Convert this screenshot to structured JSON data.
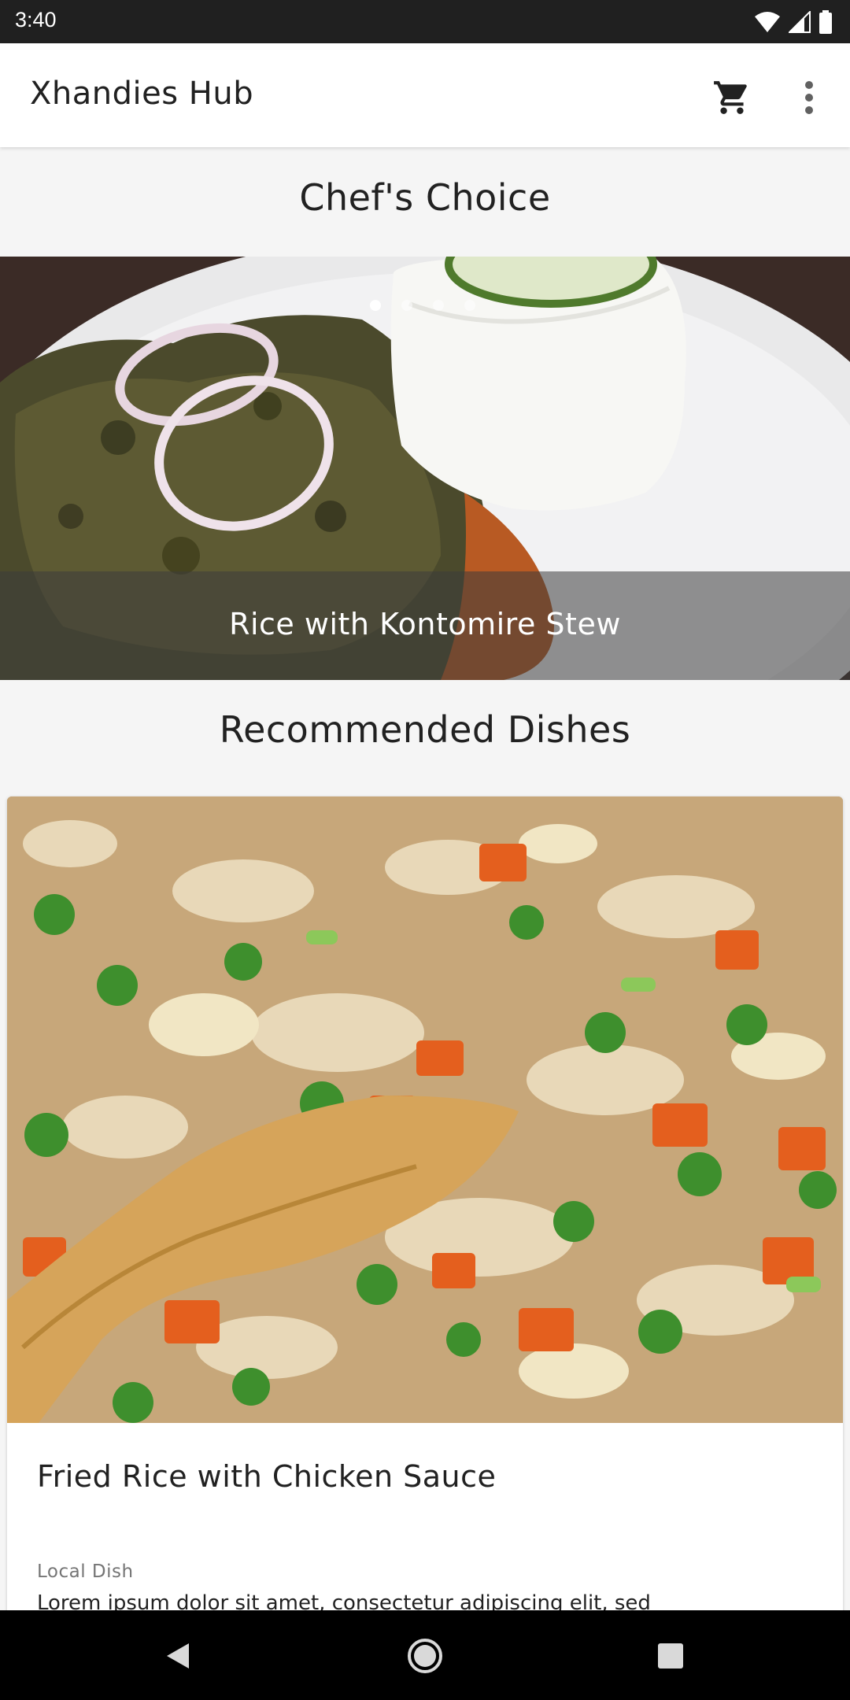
{
  "status_bar": {
    "time": "3:40",
    "icons": [
      "wifi-icon",
      "cell-signal-icon",
      "battery-icon"
    ]
  },
  "app_bar": {
    "title": "Xhandies Hub",
    "actions": [
      "cart-icon",
      "more-vert-icon"
    ]
  },
  "chefs_choice": {
    "heading": "Chef's Choice",
    "slide_count": 4,
    "active_slide": 0,
    "caption": "Rice with Kontomire Stew"
  },
  "recommended": {
    "heading": "Recommended Dishes",
    "cards": [
      {
        "title": "Fried Rice with Chicken Sauce",
        "category": "Local Dish",
        "description": "Lorem ipsum dolor sit amet, consectetur adipiscing elit, sed"
      }
    ]
  },
  "nav_bar": {
    "buttons": [
      "back-icon",
      "home-icon",
      "recents-icon"
    ]
  }
}
